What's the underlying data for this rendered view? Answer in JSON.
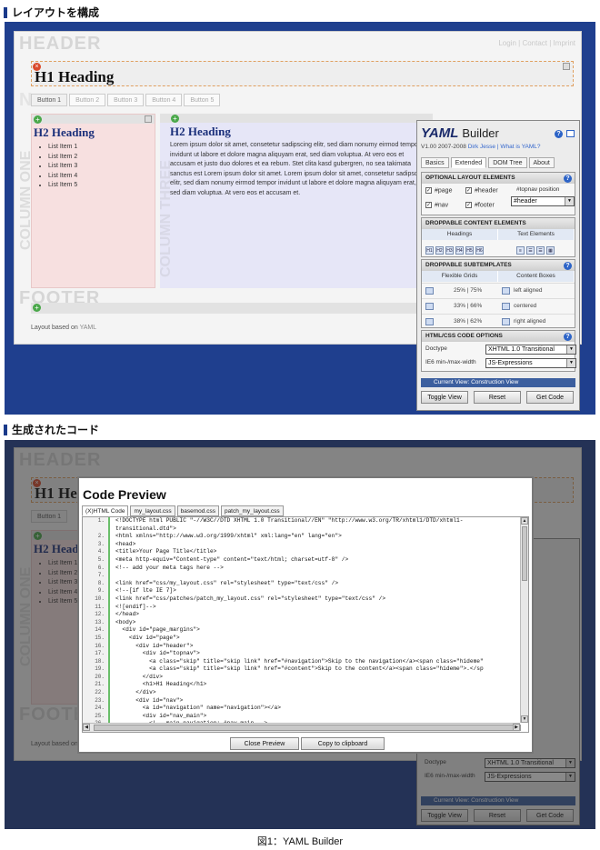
{
  "sections": {
    "layout_title": "レイアウトを構成",
    "code_title": "生成されたコード"
  },
  "page": {
    "header_text": "HEADER",
    "top_links": "Login | Contact | Imprint",
    "h1": "H1 Heading",
    "nav_buttons": [
      "Button 1",
      "Button 2",
      "Button 3",
      "Button 4",
      "Button 5"
    ],
    "col1_vertical": "COLUMN ONE",
    "col3_vertical": "COLUMN THREE",
    "h2": "H2 Heading",
    "list_items": [
      "List Item 1",
      "List Item 2",
      "List Item 3",
      "List Item 4",
      "List Item 5"
    ],
    "lorem": "Lorem ipsum dolor sit amet, consetetur sadipscing elitr, sed diam nonumy eirmod tempor invidunt ut labore et dolore magna aliquyam erat, sed diam voluptua. At vero eos et accusam et justo duo dolores et ea rebum. Stet clita kasd gubergren, no sea takimata sanctus est Lorem ipsum dolor sit amet. Lorem ipsum dolor sit amet, consetetur sadipscing elitr, sed diam nonumy eirmod tempor invidunt ut labore et dolore magna aliquyam erat, sed diam voluptua. At vero eos et accusam et.",
    "footer_text": "FOOTER",
    "layout_based": "Layout based on",
    "layout_yaml": "YAML"
  },
  "builder": {
    "logo": "YAML",
    "logo_word": "Builder",
    "version": "V1.00 2007-2008",
    "author_link": "Dirk Jesse | What is YAML?",
    "tabs": [
      "Basics",
      "Extended",
      "DOM Tree",
      "About"
    ],
    "active_tab": "Extended",
    "optional_title": "OPTIONAL LAYOUT ELEMENTS",
    "opt_page": "#page",
    "opt_header": "#header",
    "opt_nav": "#nav",
    "opt_footer": "#footer",
    "topnav_label": "#topnav position",
    "topnav_value": "#header",
    "droppable_title": "DROPPABLE CONTENT ELEMENTS",
    "headings_label": "Headings",
    "text_label": "Text Elements",
    "heading_btns": [
      "H1",
      "H2",
      "H3",
      "H4",
      "H5",
      "H6"
    ],
    "subtemplates_title": "DROPPABLE SUBTEMPLATES",
    "grids_label": "Flexible Grids",
    "boxes_label": "Content Boxes",
    "grid_rows": [
      "25% | 75%",
      "33% | 66%",
      "38% | 62%"
    ],
    "box_rows": [
      "left aligned",
      "centered",
      "right aligned"
    ],
    "htmlcss_title": "HTML/CSS CODE OPTIONS",
    "doctype_label": "Doctype",
    "doctype_value": "XHTML 1.0 Transitional",
    "ie6_label": "IE6 min-/max-width",
    "ie6_value": "JS-Expressions",
    "current_view": "Current View: Construction View",
    "toggle": "Toggle View",
    "reset": "Reset",
    "get_code": "Get Code"
  },
  "code_preview": {
    "title": "Code Preview",
    "tabs": [
      "(X)HTML Code",
      "my_layout.css",
      "basemod.css",
      "patch_my_layout.css"
    ],
    "line_numbers": [
      "1.",
      "",
      "2.",
      "3.",
      "4.",
      "5.",
      "6.",
      "7.",
      "8.",
      "9.",
      "10.",
      "11.",
      "12.",
      "13.",
      "14.",
      "15.",
      "16.",
      "17.",
      "18.",
      "19.",
      "20.",
      "21.",
      "22.",
      "23.",
      "24.",
      "25.",
      "26.",
      "27."
    ],
    "lines": [
      "<!DOCTYPE html PUBLIC \"-//W3C//DTD XHTML 1.0 Transitional//EN\" \"http://www.w3.org/TR/xhtml1/DTD/xhtml1-",
      "transitional.dtd\">",
      "<html xmlns=\"http://www.w3.org/1999/xhtml\" xml:lang=\"en\" lang=\"en\">",
      "<head>",
      "<title>Your Page Title</title>",
      "<meta http-equiv=\"Content-type\" content=\"text/html; charset=utf-8\" />",
      "<!-- add your meta tags here -->",
      "",
      "<link href=\"css/my_layout.css\" rel=\"stylesheet\" type=\"text/css\" />",
      "<!--[if lte IE 7]>",
      "<link href=\"css/patches/patch_my_layout.css\" rel=\"stylesheet\" type=\"text/css\" />",
      "<![endif]-->",
      "</head>",
      "<body>",
      "  <div id=\"page_margins\">",
      "    <div id=\"page\">",
      "      <div id=\"header\">",
      "        <div id=\"topnav\">",
      "          <a class=\"skip\" title=\"skip link\" href=\"#navigation\">Skip to the navigation</a><span class=\"hideme\"",
      "          <a class=\"skip\" title=\"skip link\" href=\"#content\">Skip to the content</a><span class=\"hideme\">.</sp",
      "        </div>",
      "        <h1>H1 Heading</h1>",
      "      </div>",
      "      <div id=\"nav\">",
      "        <a id=\"navigation\" name=\"navigation\"></a>",
      "        <div id=\"nav_main\">",
      "          <!-- main navigation: #nav_main -->",
      "          <ul>"
    ],
    "close": "Close Preview",
    "copy": "Copy to clipboard"
  },
  "caption": "図1：YAML Builder"
}
